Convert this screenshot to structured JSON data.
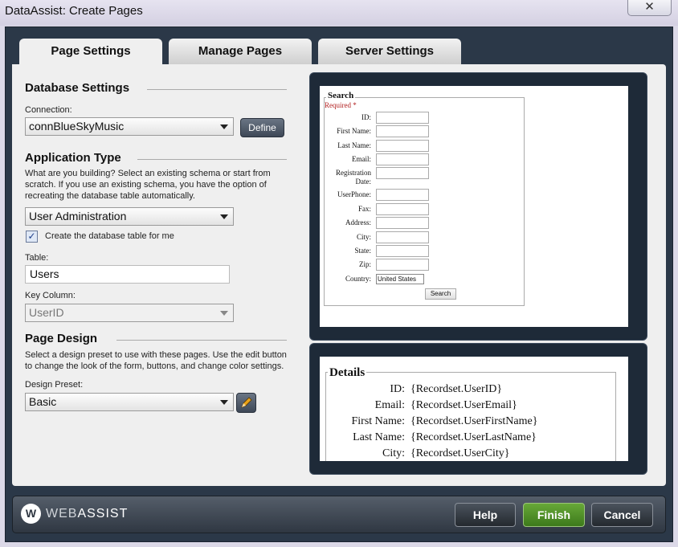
{
  "window": {
    "title": "DataAssist: Create Pages",
    "close_glyph": "✕"
  },
  "tabs": [
    {
      "label": "Page Settings",
      "active": true
    },
    {
      "label": "Manage Pages",
      "active": false
    },
    {
      "label": "Server Settings",
      "active": false
    }
  ],
  "database_settings": {
    "title": "Database Settings",
    "connection_label": "Connection:",
    "connection_value": "connBlueSkyMusic",
    "define_label": "Define"
  },
  "application_type": {
    "title": "Application Type",
    "description": "What are you building? Select an existing schema or start from scratch. If you use an existing schema, you have the option of recreating the database table automatically.",
    "value": "User Administration",
    "create_table_label": "Create the database table for me",
    "create_table_checked": true,
    "table_label": "Table:",
    "table_value": "Users",
    "key_column_label": "Key Column:",
    "key_column_value": "UserID"
  },
  "page_design": {
    "title": "Page Design",
    "description": "Select a design preset to use with these pages. Use the edit button to change the look of the form, buttons, and change color settings.",
    "preset_label": "Design Preset:",
    "preset_value": "Basic"
  },
  "search_preview": {
    "legend": "Search",
    "required": "Required *",
    "fields": [
      "ID:",
      "First Name:",
      "Last Name:",
      "Email:",
      "Registration Date:",
      "UserPhone:",
      "Fax:",
      "Address:",
      "City:",
      "State:",
      "Zip:"
    ],
    "country_label": "Country:",
    "country_value": "United States",
    "search_button": "Search"
  },
  "details_preview": {
    "legend": "Details",
    "rows": [
      {
        "label": "ID:",
        "value": "{Recordset.UserID}"
      },
      {
        "label": "Email:",
        "value": "{Recordset.UserEmail}"
      },
      {
        "label": "First Name:",
        "value": "{Recordset.UserFirstName}"
      },
      {
        "label": "Last Name:",
        "value": "{Recordset.UserLastName}"
      },
      {
        "label": "City:",
        "value": "{Recordset.UserCity}"
      }
    ]
  },
  "footer": {
    "logo_mark": "W",
    "logo_web": "WEB",
    "logo_assist": "ASSIST",
    "help_label": "Help",
    "finish_label": "Finish",
    "cancel_label": "Cancel"
  },
  "colors": {
    "finish_green": "#4a8c24",
    "frame_dark": "#2b3848"
  }
}
